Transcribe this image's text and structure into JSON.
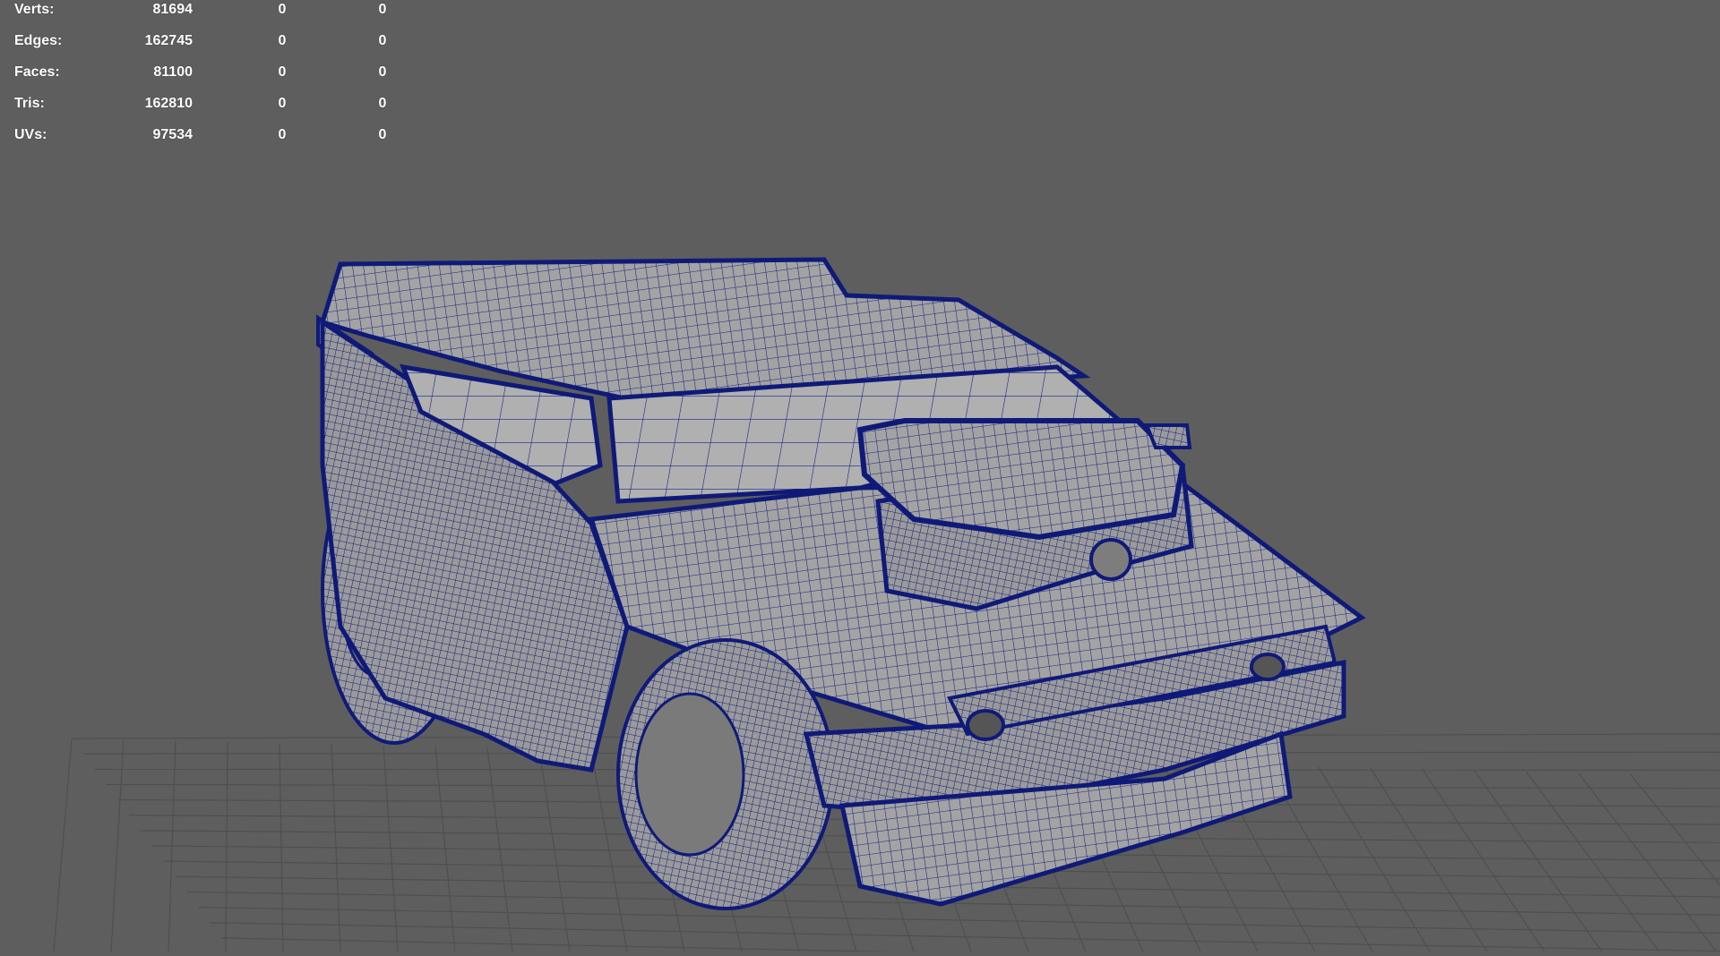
{
  "viewport": {
    "background": "#5e5e5e",
    "grid_color": "#4f4f4f",
    "wire_color": "#0f1a78",
    "surface_color": "#9c9c9c"
  },
  "hud": {
    "rows": [
      {
        "label": "Verts:",
        "total": "81694",
        "selected": "0",
        "component": "0"
      },
      {
        "label": "Edges:",
        "total": "162745",
        "selected": "0",
        "component": "0"
      },
      {
        "label": "Faces:",
        "total": "81100",
        "selected": "0",
        "component": "0"
      },
      {
        "label": "Tris:",
        "total": "162810",
        "selected": "0",
        "component": "0"
      },
      {
        "label": "UVs:",
        "total": "97534",
        "selected": "0",
        "component": "0"
      }
    ]
  }
}
